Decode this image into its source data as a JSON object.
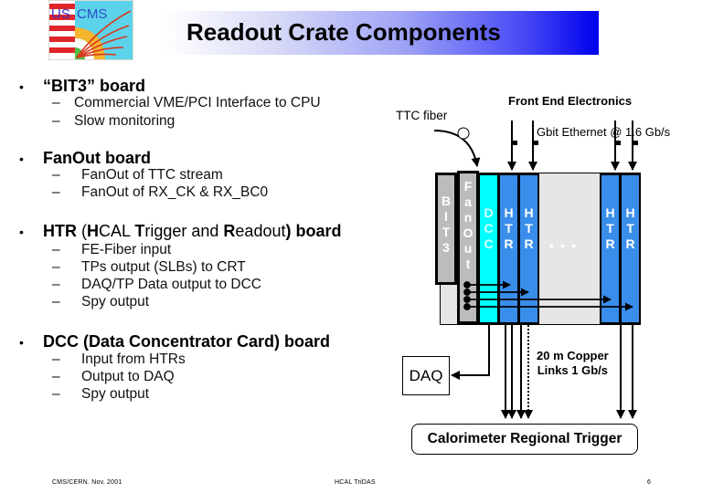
{
  "header": {
    "logo_text": "US CMS",
    "title": "Readout Crate Components"
  },
  "bullets": [
    {
      "heading_parts": [
        {
          "text": "“BIT3” board",
          "bold": true
        }
      ],
      "items": [
        "Commercial VME/PCI Interface to CPU",
        "Slow monitoring"
      ]
    },
    {
      "heading_parts": [
        {
          "text": "FanOut",
          "bold": true
        },
        {
          "text": " board",
          "bold": true
        }
      ],
      "items": [
        "FanOut of TTC stream",
        "FanOut of RX_CK & RX_BC0"
      ]
    },
    {
      "heading_parts": [
        {
          "text": "HTR",
          "bold": true
        },
        {
          "text": " (",
          "bold": false
        },
        {
          "text": "H",
          "bold": true
        },
        {
          "text": "CAL ",
          "bold": false
        },
        {
          "text": "T",
          "bold": true
        },
        {
          "text": "rigger and ",
          "bold": false
        },
        {
          "text": "R",
          "bold": true
        },
        {
          "text": "eadout",
          "bold": false
        },
        {
          "text": ") board",
          "bold": true
        }
      ],
      "items": [
        "FE-Fiber input",
        "TPs output (SLBs) to CRT",
        "DAQ/TP Data output to DCC",
        "Spy output"
      ]
    },
    {
      "heading_parts": [
        {
          "text": "DCC (Data Concentrator Card) board",
          "bold": true
        }
      ],
      "items": [
        "Input from HTRs",
        "Output to DAQ",
        "Spy output"
      ]
    }
  ],
  "diagram": {
    "front_end_label": "Front End Electronics",
    "ttc_fiber_label": "TTC fiber",
    "gbit_label": "Gbit Ethernet @ 1.6 Gb/s",
    "copper_label_line1": "20 m Copper",
    "copper_label_line2": "Links 1 Gb/s",
    "daq_label": "DAQ",
    "crt_label": "Calorimeter Regional Trigger",
    "ellipsis": "• • •",
    "boards": [
      {
        "name": "BIT3",
        "letters": [
          "B",
          "I",
          "T",
          "3"
        ],
        "color": "#bcbcbc"
      },
      {
        "name": "FanOut",
        "letters": [
          "F",
          "a",
          "n",
          "O",
          "u",
          "t"
        ],
        "color": "#bcbcbc"
      },
      {
        "name": "DCC",
        "letters": [
          "D",
          "C",
          "C"
        ],
        "color": "#00ffff"
      },
      {
        "name": "HTR",
        "letters": [
          "H",
          "T",
          "R"
        ],
        "color": "#3a8eeb"
      },
      {
        "name": "HTR",
        "letters": [
          "H",
          "T",
          "R"
        ],
        "color": "#3a8eeb"
      },
      {
        "name": "HTR",
        "letters": [
          "H",
          "T",
          "R"
        ],
        "color": "#3a8eeb"
      },
      {
        "name": "HTR",
        "letters": [
          "H",
          "T",
          "R"
        ],
        "color": "#3a8eeb"
      }
    ],
    "crate_bg_color": "#e6e6e6"
  },
  "footer": {
    "left": "CMS/CERN. Nov. 2001",
    "center": "HCAL TriDAS",
    "page": "6"
  }
}
